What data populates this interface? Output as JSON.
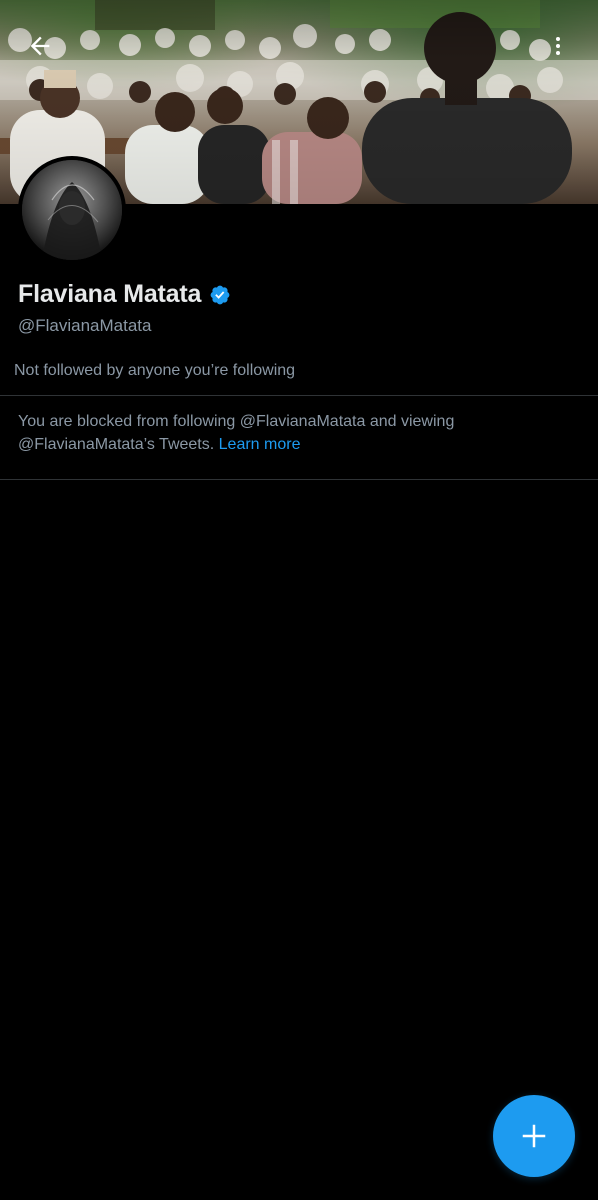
{
  "profile": {
    "display_name": "Flaviana Matata",
    "handle": "@FlavianaMatata",
    "verified": true,
    "followed_by_text": "Not followed by anyone you’re following"
  },
  "blocked": {
    "message": "You are blocked from following @FlavianaMatata and viewing @FlavianaMatata’s Tweets.",
    "learn_more_label": "Learn more"
  },
  "icons": {
    "back": "arrow-left-icon",
    "more": "more-vertical-icon",
    "verified": "verified-badge-icon",
    "compose": "plus-icon"
  },
  "colors": {
    "background": "#000000",
    "accent": "#1d9bf0",
    "primary_text": "#e7e9ea",
    "secondary_text": "#8b98a5",
    "divider": "#2f3336"
  }
}
